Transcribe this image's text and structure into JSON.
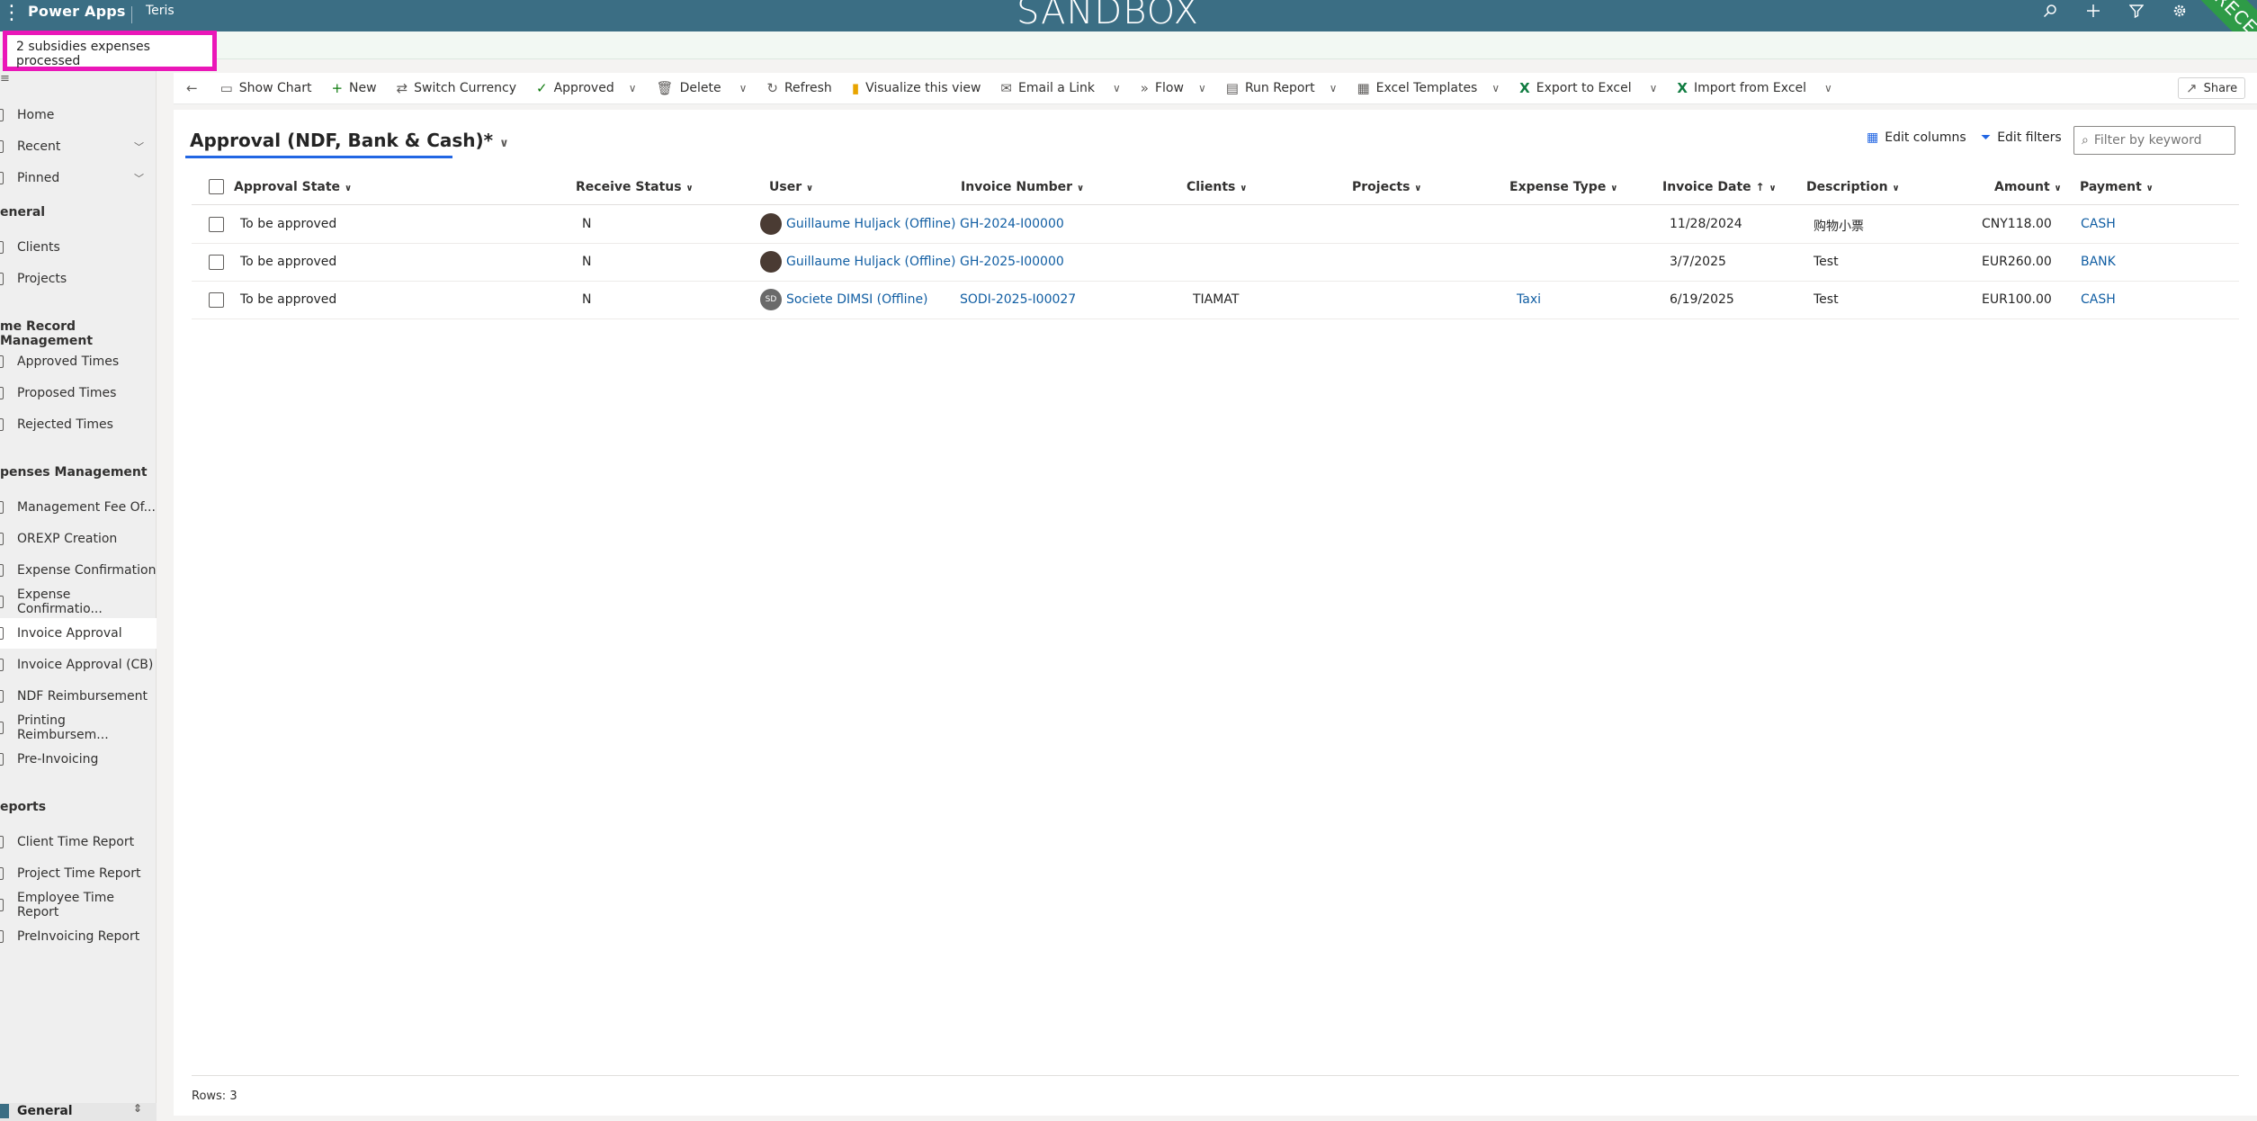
{
  "topbar": {
    "app_name": "Power Apps",
    "env_name": "Teris",
    "banner": "SANDBOX",
    "ribbon": "RECETTE"
  },
  "notification": {
    "text": "2 subsidies expenses processed"
  },
  "sidebar": {
    "items_top": [
      {
        "label": "Home"
      },
      {
        "label": "Recent"
      },
      {
        "label": "Pinned"
      }
    ],
    "groups": [
      {
        "title": "eneral",
        "items": [
          {
            "label": "Clients"
          },
          {
            "label": "Projects"
          }
        ]
      },
      {
        "title": "me Record Management",
        "items": [
          {
            "label": "Approved Times"
          },
          {
            "label": "Proposed Times"
          },
          {
            "label": "Rejected Times"
          }
        ]
      },
      {
        "title": "penses Management",
        "items": [
          {
            "label": "Management Fee Of..."
          },
          {
            "label": "OREXP Creation"
          },
          {
            "label": "Expense Confirmation"
          },
          {
            "label": "Expense Confirmatio..."
          },
          {
            "label": "Invoice Approval"
          },
          {
            "label": "Invoice Approval (CB)"
          },
          {
            "label": "NDF Reimbursement"
          },
          {
            "label": "Printing Reimbursem..."
          },
          {
            "label": "Pre-Invoicing"
          }
        ]
      },
      {
        "title": "eports",
        "items": [
          {
            "label": "Client Time Report"
          },
          {
            "label": "Project Time Report"
          },
          {
            "label": "Employee Time Report"
          },
          {
            "label": "PreInvoicing Report"
          }
        ]
      }
    ],
    "area": "General"
  },
  "commands": {
    "show_chart": "Show Chart",
    "new": "New",
    "switch_currency": "Switch Currency",
    "approved": "Approved",
    "delete": "Delete",
    "refresh": "Refresh",
    "visualize": "Visualize this view",
    "email_link": "Email a Link",
    "flow": "Flow",
    "run_report": "Run Report",
    "excel_templates": "Excel Templates",
    "export_excel": "Export to Excel",
    "import_excel": "Import from Excel",
    "share": "Share"
  },
  "view": {
    "title": "Approval (NDF, Bank & Cash)*",
    "edit_columns": "Edit columns",
    "edit_filters": "Edit filters",
    "filter_placeholder": "Filter by keyword"
  },
  "grid": {
    "columns": [
      "Approval State",
      "Receive Status",
      "User",
      "Invoice Number",
      "Clients",
      "Projects",
      "Expense Type",
      "Invoice Date",
      "Description",
      "Amount",
      "Payment"
    ],
    "rows": [
      {
        "approval_state": "To be approved",
        "receive_status": "N",
        "user": "Guillaume Huljack (Offline)",
        "user_initials": "",
        "invoice_number": "GH-2024-I00000",
        "clients": "",
        "projects": "",
        "expense_type": "",
        "invoice_date": "11/28/2024",
        "description": "购物小票",
        "amount": "CNY118.00",
        "payment": "CASH"
      },
      {
        "approval_state": "To be approved",
        "receive_status": "N",
        "user": "Guillaume Huljack (Offline)",
        "user_initials": "",
        "invoice_number": "GH-2025-I00000",
        "clients": "",
        "projects": "",
        "expense_type": "",
        "invoice_date": "3/7/2025",
        "description": "Test",
        "amount": "EUR260.00",
        "payment": "BANK"
      },
      {
        "approval_state": "To be approved",
        "receive_status": "N",
        "user": "Societe DIMSI (Offline)",
        "user_initials": "SD",
        "invoice_number": "SODI-2025-I00027",
        "clients": "TIAMAT",
        "projects": "",
        "expense_type": "Taxi",
        "invoice_date": "6/19/2025",
        "description": "Test",
        "amount": "EUR100.00",
        "payment": "CASH"
      }
    ],
    "footer": "Rows: 3"
  }
}
